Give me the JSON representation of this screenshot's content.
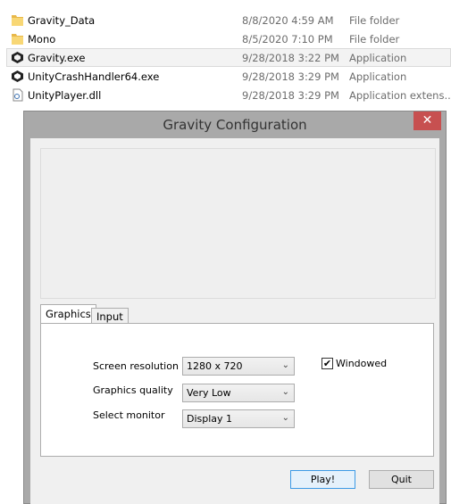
{
  "files": [
    {
      "name": "Gravity_Data",
      "date": "8/8/2020 4:59 AM",
      "type": "File folder",
      "icon": "folder-icon"
    },
    {
      "name": "Mono",
      "date": "8/5/2020 7:10 PM",
      "type": "File folder",
      "icon": "folder-icon"
    },
    {
      "name": "Gravity.exe",
      "date": "9/28/2018 3:22 PM",
      "type": "Application",
      "icon": "unity-icon",
      "selected": true
    },
    {
      "name": "UnityCrashHandler64.exe",
      "date": "9/28/2018 3:29 PM",
      "type": "Application",
      "icon": "unity-icon"
    },
    {
      "name": "UnityPlayer.dll",
      "date": "9/28/2018 3:29 PM",
      "type": "Application extens...",
      "icon": "dll-file-icon"
    }
  ],
  "dialog": {
    "title": "Gravity Configuration",
    "close": "✕",
    "tabs": [
      "Graphics",
      "Input"
    ],
    "labels": {
      "resolution": "Screen resolution",
      "quality": "Graphics quality",
      "monitor": "Select monitor"
    },
    "values": {
      "resolution": "1280 x 720",
      "quality": "Very Low",
      "monitor": "Display 1"
    },
    "windowed": {
      "label": "Windowed",
      "checked": true
    },
    "play": "Play!",
    "quit": "Quit"
  }
}
